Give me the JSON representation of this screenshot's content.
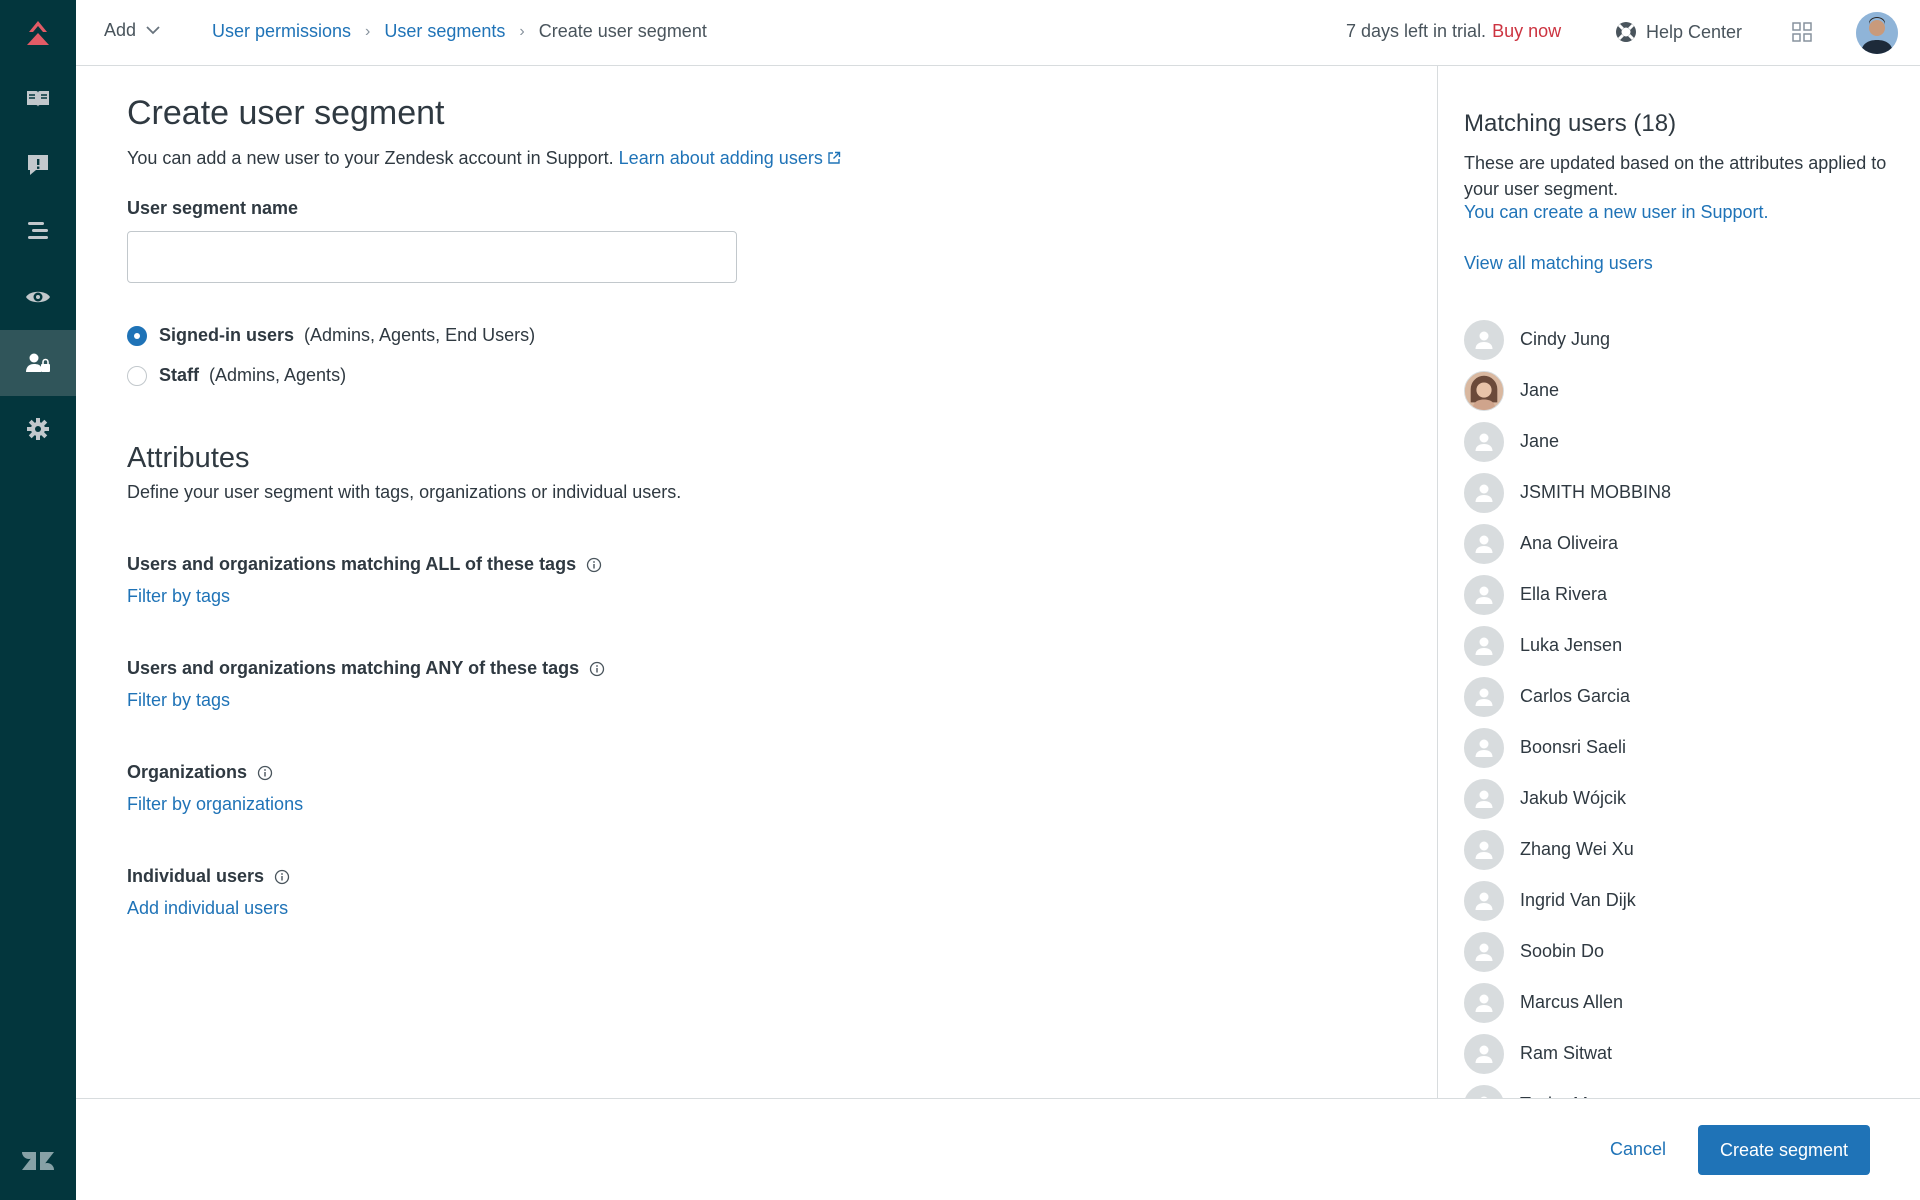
{
  "topbar": {
    "add_label": "Add",
    "breadcrumb": [
      "User permissions",
      "User segments",
      "Create user segment"
    ],
    "trial_text": "7 days left in trial.",
    "buy_now": "Buy now",
    "help_center": "Help Center"
  },
  "sidebar": {
    "items": [
      "guide-icon",
      "alert-icon",
      "arrange-icon",
      "eye-icon",
      "user-permissions-icon",
      "gear-icon"
    ],
    "active_index": 4
  },
  "main": {
    "title": "Create user segment",
    "intro_text": "You can add a new user to your Zendesk account in Support.",
    "intro_link": "Learn about adding users",
    "name_label": "User segment name",
    "name_value": "",
    "radios": [
      {
        "label": "Signed-in users",
        "detail": "(Admins, Agents, End Users)",
        "checked": true
      },
      {
        "label": "Staff",
        "detail": "(Admins, Agents)",
        "checked": false
      }
    ],
    "attributes_title": "Attributes",
    "attributes_desc": "Define your user segment with tags, organizations or individual users.",
    "sections": [
      {
        "label": "Users and organizations matching ALL of these tags",
        "link": "Filter by tags"
      },
      {
        "label": "Users and organizations matching ANY of these tags",
        "link": "Filter by tags"
      },
      {
        "label": "Organizations",
        "link": "Filter by organizations"
      },
      {
        "label": "Individual users",
        "link": "Add individual users"
      }
    ]
  },
  "panel": {
    "title": "Matching users (18)",
    "desc": "These are updated based on the attributes applied to your user segment.",
    "create_link": "You can create a new user in Support.",
    "view_all": "View all matching users",
    "users": [
      "Cindy Jung",
      "Jane",
      "Jane",
      "JSMITH MOBBIN8",
      "Ana Oliveira",
      "Ella Rivera",
      "Luka Jensen",
      "Carlos Garcia",
      "Boonsri Saeli",
      "Jakub Wójcik",
      "Zhang Wei Xu",
      "Ingrid Van Dijk",
      "Soobin Do",
      "Marcus Allen",
      "Ram Sitwat",
      "Taylor Moore"
    ]
  },
  "footer": {
    "cancel": "Cancel",
    "create": "Create segment"
  },
  "colors": {
    "sidebar": "#03363d",
    "link": "#1f73b7",
    "buy_now": "#cc3340",
    "brand_red": "#e35b66"
  }
}
